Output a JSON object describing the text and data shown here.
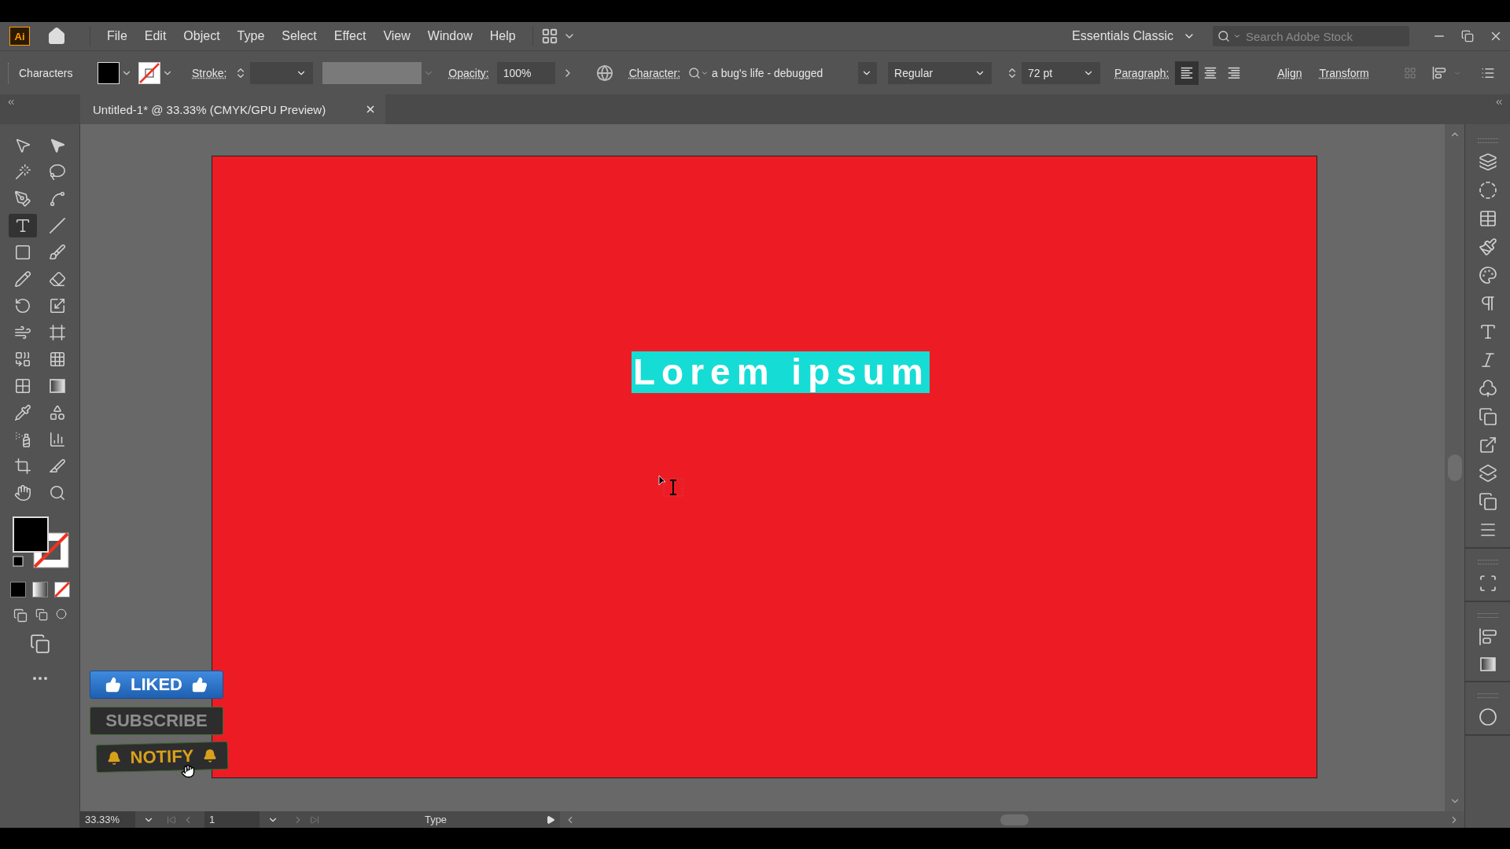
{
  "app": {
    "logo": "Ai"
  },
  "menu": [
    "File",
    "Edit",
    "Object",
    "Type",
    "Select",
    "Effect",
    "View",
    "Window",
    "Help"
  ],
  "workspace": {
    "label": "Essentials Classic"
  },
  "search": {
    "placeholder": "Search Adobe Stock"
  },
  "control_bar": {
    "selection": "Characters",
    "stroke_label": "Stroke:",
    "opacity_label": "Opacity:",
    "opacity": "100%",
    "character_label": "Character:",
    "font": "a bug's life - debugged",
    "style": "Regular",
    "size": "72 pt",
    "paragraph_label": "Paragraph:",
    "alignments": [
      {
        "kind": "left",
        "selected": true
      },
      {
        "kind": "center",
        "selected": false
      },
      {
        "kind": "right",
        "selected": false
      }
    ],
    "align": "Align",
    "transform": "Transform"
  },
  "document_tab": {
    "title": "Untitled-1* @ 33.33% (CMYK/GPU Preview)"
  },
  "tools": [
    {
      "kind": "selection",
      "selected": false
    },
    {
      "kind": "direct",
      "selected": false
    },
    {
      "kind": "magic",
      "selected": false
    },
    {
      "kind": "lasso",
      "selected": false
    },
    {
      "kind": "pen",
      "selected": false
    },
    {
      "kind": "curvature",
      "selected": false
    },
    {
      "kind": "type",
      "selected": true
    },
    {
      "kind": "line",
      "selected": false
    },
    {
      "kind": "rectangle",
      "selected": false
    },
    {
      "kind": "brush",
      "selected": false
    },
    {
      "kind": "shaper",
      "selected": false
    },
    {
      "kind": "eraser",
      "selected": false
    },
    {
      "kind": "rotate",
      "selected": false
    },
    {
      "kind": "scale",
      "selected": false
    },
    {
      "kind": "warp",
      "selected": false
    },
    {
      "kind": "free_transform",
      "selected": false
    },
    {
      "kind": "shape_builder",
      "selected": false
    },
    {
      "kind": "perspective",
      "selected": false
    },
    {
      "kind": "mesh",
      "selected": false
    },
    {
      "kind": "gradient",
      "selected": false
    },
    {
      "kind": "eyedropper",
      "selected": false
    },
    {
      "kind": "blend",
      "selected": false
    },
    {
      "kind": "sprayer",
      "selected": false
    },
    {
      "kind": "graph",
      "selected": false
    },
    {
      "kind": "artboard",
      "selected": false
    },
    {
      "kind": "slice",
      "selected": false
    },
    {
      "kind": "hand",
      "selected": false
    },
    {
      "kind": "zoom",
      "selected": false
    }
  ],
  "panel_groups": [
    [
      {
        "kind": "layers"
      },
      {
        "kind": "appearance"
      },
      {
        "kind": "swatches"
      },
      {
        "kind": "brushes"
      },
      {
        "kind": "palette"
      },
      {
        "kind": "paragraph"
      },
      {
        "kind": "character"
      },
      {
        "kind": "glyphs"
      },
      {
        "kind": "symbols"
      },
      {
        "kind": "place"
      },
      {
        "kind": "export"
      },
      {
        "kind": "pathfinder"
      },
      {
        "kind": "transparency"
      },
      {
        "kind": "stroke"
      }
    ],
    [
      {
        "kind": "transform"
      }
    ],
    [
      {
        "kind": "align"
      },
      {
        "kind": "gradient"
      }
    ],
    [
      {
        "kind": "color"
      }
    ]
  ],
  "artboard": {
    "text": "Lorem ipsum",
    "text_selected": true
  },
  "overlay_buttons": [
    {
      "kind": "liked",
      "label": "LIKED"
    },
    {
      "kind": "subscribe",
      "label": "SUBSCRIBE"
    },
    {
      "kind": "notify",
      "label": "NOTIFY"
    }
  ],
  "status_bar": {
    "zoom": "33.33%",
    "artboard": "1",
    "tool": "Type"
  }
}
